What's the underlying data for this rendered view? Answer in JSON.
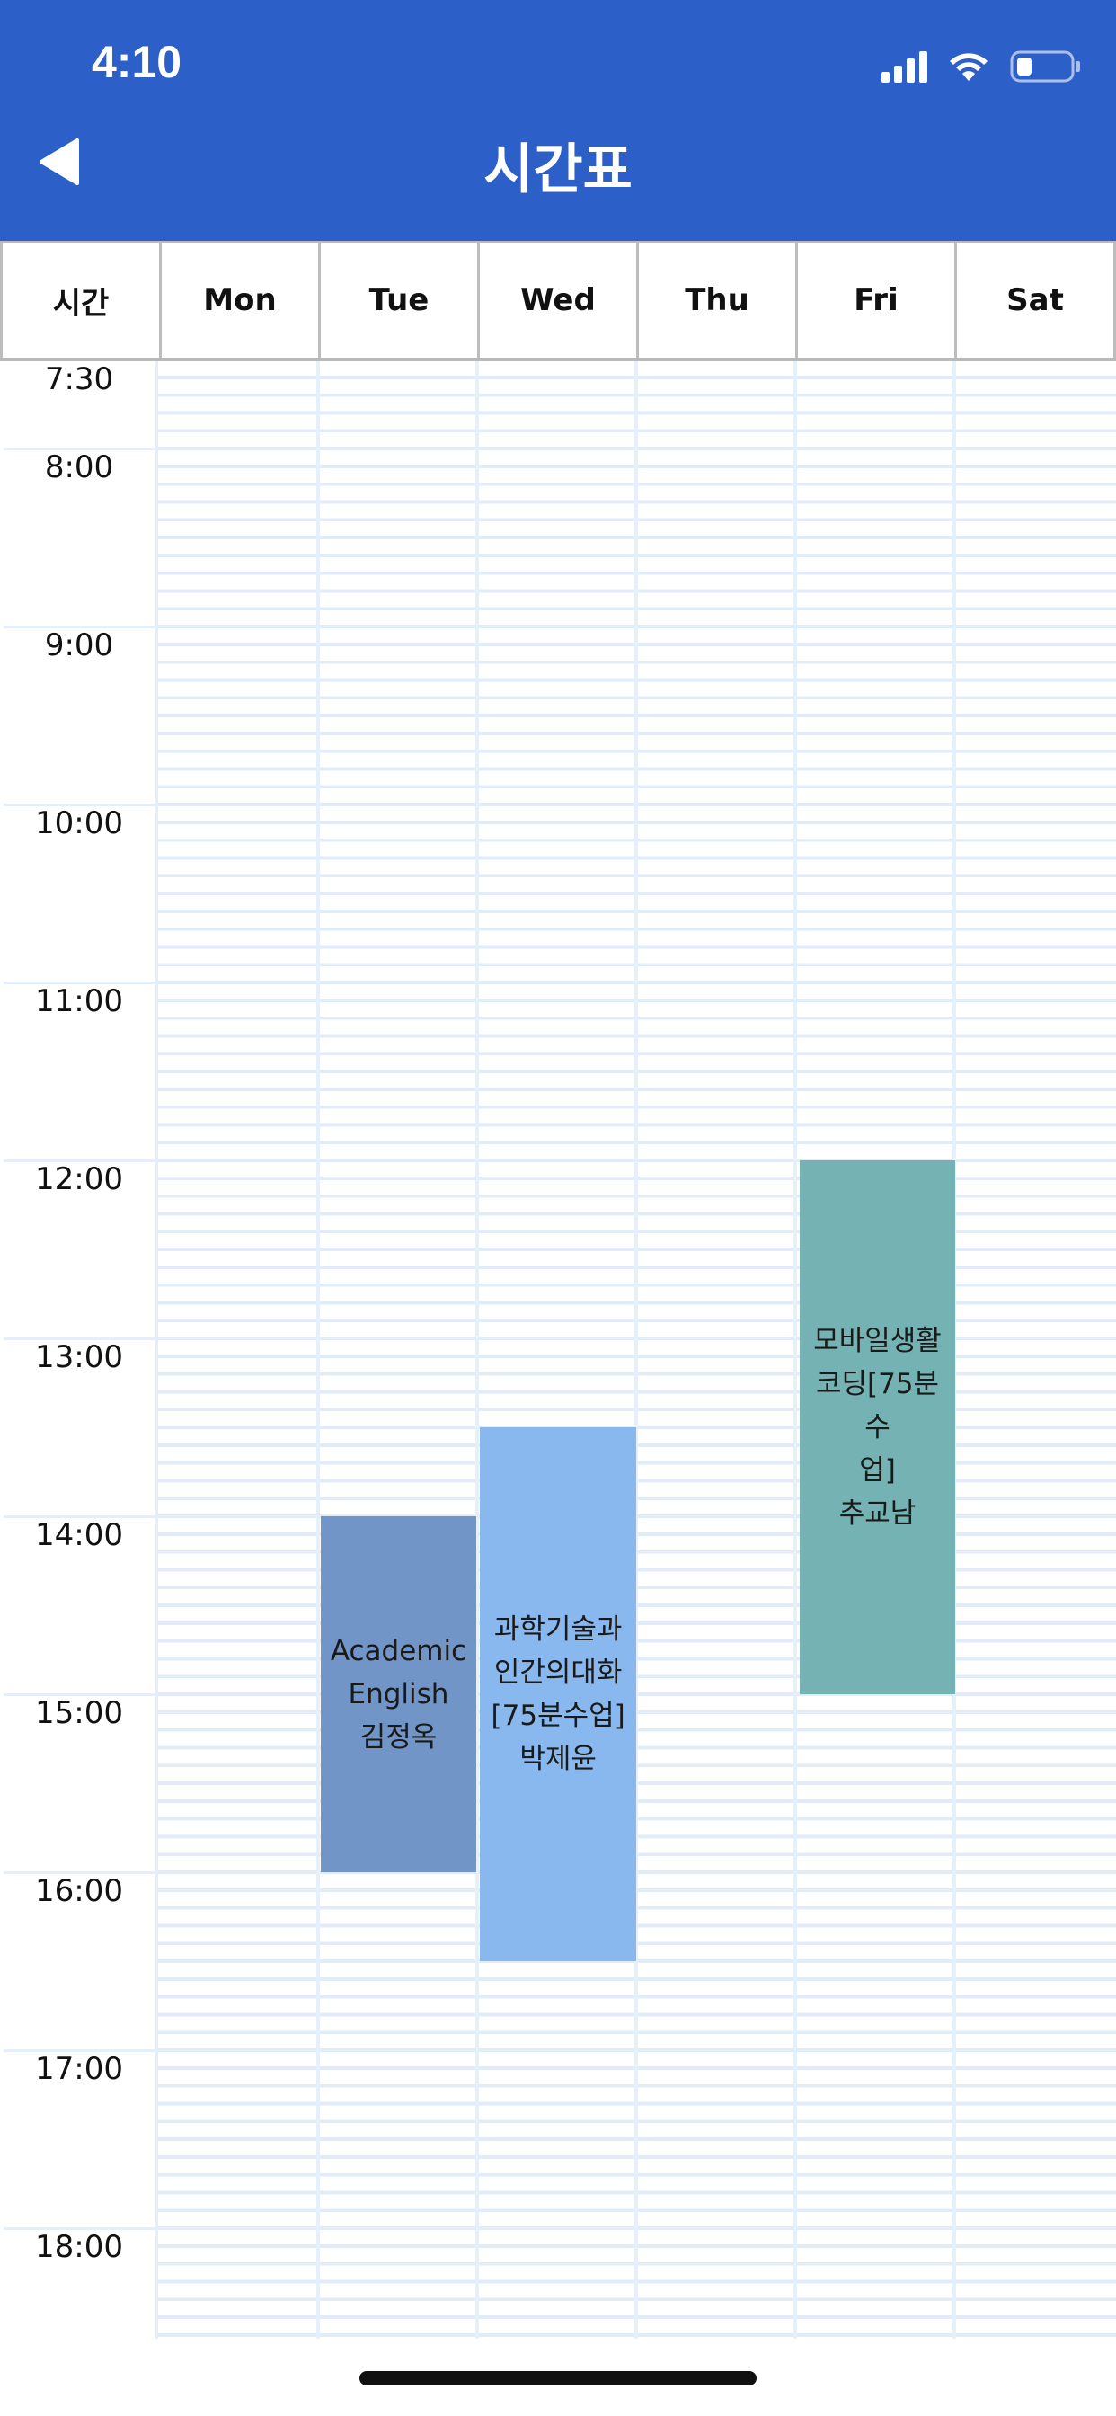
{
  "status_bar": {
    "time": "4:10"
  },
  "nav": {
    "title": "시간표"
  },
  "header": {
    "time_col": "시간",
    "days": [
      "Mon",
      "Tue",
      "Wed",
      "Thu",
      "Fri",
      "Sat"
    ]
  },
  "times": [
    "7:30",
    "8:00",
    "9:00",
    "10:00",
    "11:00",
    "12:00",
    "13:00",
    "14:00",
    "15:00",
    "16:00",
    "17:00",
    "18:00"
  ],
  "courses": [
    {
      "day": "Tue",
      "start": "14:00",
      "end": "16:00",
      "color": "#7095c6",
      "text": "Academic\nEnglish\n김정옥"
    },
    {
      "day": "Wed",
      "start": "13:30",
      "end": "16:30",
      "color": "#88b8ee",
      "text": "과학기술과\n인간의대화\n[75분수업]\n박제윤"
    },
    {
      "day": "Fri",
      "start": "12:00",
      "end": "15:00",
      "color": "#75b2b3",
      "text": "모바일생활\n코딩[75분수\n업]\n추교남"
    }
  ],
  "colors": {
    "accent": "#2c5fc8"
  }
}
